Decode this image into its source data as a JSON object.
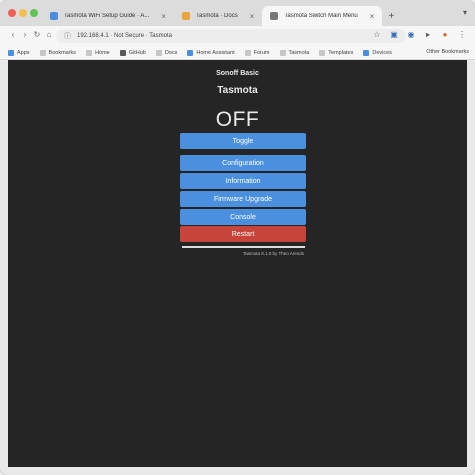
{
  "browser": {
    "tabs": [
      {
        "title": "Tasmota WiFi Setup Guide · A...",
        "active": false,
        "favicon_color": "#4a8de0"
      },
      {
        "title": "Tasmota · Docs",
        "active": false,
        "favicon_color": "#e8a33b"
      },
      {
        "title": "Tasmota Switch Main Menu",
        "active": true,
        "favicon_color": "#777777"
      }
    ],
    "new_tab_label": "+",
    "tabstrip_right_icon": "chevron-down-icon",
    "address": "192.168.4.1 · Not Secure · Tasmota",
    "toolbar_icons": [
      "star-icon",
      "extensions-icon",
      "profile-icon",
      "menu-icon"
    ],
    "bookmarks": [
      {
        "label": "Apps",
        "color": "#4b90df"
      },
      {
        "label": "Bookmarks",
        "color": "#c6c6c6"
      },
      {
        "label": "Home",
        "color": "#c6c6c6"
      },
      {
        "label": "GitHub",
        "color": "#5a5a5a"
      },
      {
        "label": "Docs",
        "color": "#c6c6c6"
      },
      {
        "label": "Home Assistant",
        "color": "#4b90df"
      },
      {
        "label": "Forum",
        "color": "#c6c6c6"
      },
      {
        "label": "Tasmota",
        "color": "#c6c6c6"
      },
      {
        "label": "Templates",
        "color": "#c6c6c6"
      },
      {
        "label": "Devices",
        "color": "#4b90df"
      }
    ],
    "bookmarks_right": "Other Bookmarks"
  },
  "device": {
    "name": "Sonoff Basic",
    "app": "Tasmota",
    "power_state": "OFF",
    "footer": "Tasmota 8.1.0 by Theo Arends"
  },
  "buttons": {
    "toggle": "Toggle",
    "configuration": "Configuration",
    "information": "Information",
    "firmware_upgrade": "Firmware Upgrade",
    "console": "Console",
    "restart": "Restart"
  },
  "colors": {
    "page_background": "#252525",
    "button_primary": "#4b90df",
    "button_danger": "#c7443a",
    "text": "#eaeaea"
  }
}
